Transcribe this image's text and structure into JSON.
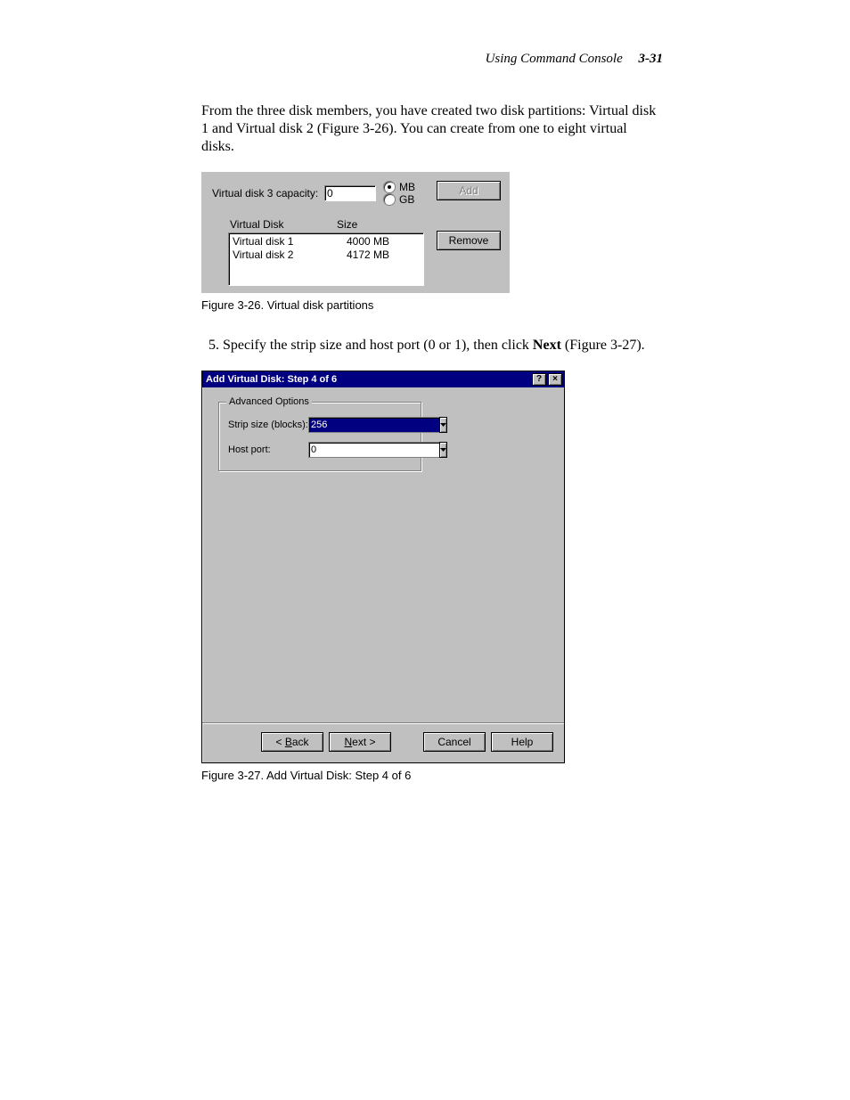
{
  "header": {
    "section_title": "Using Command Console",
    "page_number": "3-31"
  },
  "paragraph1": "From the three disk members, you have created two disk partitions: Virtual disk 1 and Virtual disk 2 (Figure 3-26). You can create from one to eight virtual disks.",
  "figure326": {
    "capacity_label": "Virtual disk 3 capacity:",
    "capacity_value": "0",
    "unit_mb": "MB",
    "unit_gb": "GB",
    "add_button": "Add",
    "remove_button": "Remove",
    "col_disk": "Virtual Disk",
    "col_size": "Size",
    "rows": [
      {
        "name": "Virtual disk 1",
        "size": "4000 MB"
      },
      {
        "name": "Virtual disk 2",
        "size": "4172 MB"
      }
    ],
    "caption": "Figure 3-26.  Virtual disk partitions"
  },
  "step5": {
    "number": "5",
    "pre": "Specify the strip size and host port (0 or 1), then click ",
    "bold": "Next",
    "post": " (Figure 3-27)."
  },
  "figure327": {
    "title": "Add Virtual Disk: Step 4 of 6",
    "help_glyph": "?",
    "close_glyph": "×",
    "group_legend": "Advanced Options",
    "strip_label": "Strip size (blocks):",
    "strip_value": "256",
    "host_label": "Host port:",
    "host_value": "0",
    "btn_back_pre": "< ",
    "btn_back_u": "B",
    "btn_back_post": "ack",
    "btn_next_u": "N",
    "btn_next_post": "ext >",
    "btn_cancel": "Cancel",
    "btn_help": "Help",
    "caption": "Figure 3-27.  Add Virtual Disk: Step 4 of 6"
  }
}
